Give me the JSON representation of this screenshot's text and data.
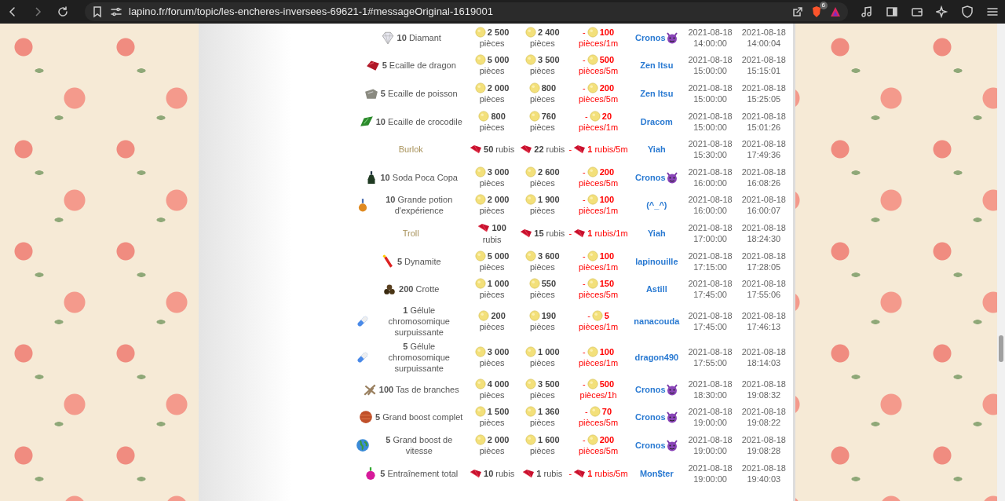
{
  "browser": {
    "url": "lapino.fr/forum/topic/les-encheres-inversees-69621-1#messageOriginal-1619001",
    "shield_count": "6"
  },
  "auctions": [
    {
      "item": {
        "kind": "diamond",
        "qty": "10",
        "name": "Diamant"
      },
      "kind": "coin",
      "start": {
        "value": "2 500",
        "unit": "pièces"
      },
      "final": {
        "value": "2 400",
        "unit": "pièces"
      },
      "step": {
        "sign": "-",
        "value": "100",
        "unit": "pièces/1m"
      },
      "winner": {
        "name": "Cronos",
        "devil": true
      },
      "opened": "2021-08-18 14:00:00",
      "closed": "2021-08-18 14:00:04"
    },
    {
      "item": {
        "kind": "scale-red",
        "qty": "5",
        "name": "Ecaille de dragon"
      },
      "kind": "coin",
      "start": {
        "value": "5 000",
        "unit": "pièces"
      },
      "final": {
        "value": "3 500",
        "unit": "pièces"
      },
      "step": {
        "sign": "-",
        "value": "500",
        "unit": "pièces/5m"
      },
      "winner": {
        "name": "Zen Itsu",
        "devil": false
      },
      "opened": "2021-08-18 15:00:00",
      "closed": "2021-08-18 15:15:01"
    },
    {
      "item": {
        "kind": "scale-grey",
        "qty": "5",
        "name": "Ecaille de poisson"
      },
      "kind": "coin",
      "start": {
        "value": "2 000",
        "unit": "pièces"
      },
      "final": {
        "value": "800",
        "unit": "pièces"
      },
      "step": {
        "sign": "-",
        "value": "200",
        "unit": "pièces/5m"
      },
      "winner": {
        "name": "Zen Itsu",
        "devil": false
      },
      "opened": "2021-08-18 15:00:00",
      "closed": "2021-08-18 15:25:05"
    },
    {
      "item": {
        "kind": "scale-green",
        "qty": "10",
        "name": "Ecaille de crocodile"
      },
      "kind": "coin",
      "start": {
        "value": "800",
        "unit": "pièces"
      },
      "final": {
        "value": "760",
        "unit": "pièces"
      },
      "step": {
        "sign": "-",
        "value": "20",
        "unit": "pièces/1m"
      },
      "winner": {
        "name": "Dracom",
        "devil": false
      },
      "opened": "2021-08-18 15:00:00",
      "closed": "2021-08-18 15:01:26"
    },
    {
      "item": {
        "kind": "creature",
        "name": "Burlok"
      },
      "kind": "ruby",
      "start": {
        "value": "50",
        "unit": "rubis"
      },
      "final": {
        "value": "22",
        "unit": "rubis"
      },
      "step": {
        "sign": "-",
        "value": "1",
        "unit": "rubis/5m"
      },
      "winner": {
        "name": "Yiah",
        "devil": false
      },
      "opened": "2021-08-18 15:30:00",
      "closed": "2021-08-18 17:49:36"
    },
    {
      "item": {
        "kind": "bottle",
        "qty": "10",
        "name": "Soda Poca Copa"
      },
      "kind": "coin",
      "start": {
        "value": "3 000",
        "unit": "pièces"
      },
      "final": {
        "value": "2 600",
        "unit": "pièces"
      },
      "step": {
        "sign": "-",
        "value": "200",
        "unit": "pièces/5m"
      },
      "winner": {
        "name": "Cronos",
        "devil": true
      },
      "opened": "2021-08-18 16:00:00",
      "closed": "2021-08-18 16:08:26"
    },
    {
      "item": {
        "kind": "potion",
        "qty": "10",
        "name": "Grande potion d'expérience"
      },
      "kind": "coin",
      "start": {
        "value": "2 000",
        "unit": "pièces"
      },
      "final": {
        "value": "1 900",
        "unit": "pièces"
      },
      "step": {
        "sign": "-",
        "value": "100",
        "unit": "pièces/1m"
      },
      "winner": {
        "name": "(^_^)",
        "devil": false
      },
      "opened": "2021-08-18 16:00:00",
      "closed": "2021-08-18 16:00:07"
    },
    {
      "item": {
        "kind": "creature",
        "name": "Troll"
      },
      "kind": "ruby",
      "start": {
        "value": "100",
        "unit": "rubis"
      },
      "final": {
        "value": "15",
        "unit": "rubis"
      },
      "step": {
        "sign": "-",
        "value": "1",
        "unit": "rubis/1m"
      },
      "winner": {
        "name": "Yiah",
        "devil": false
      },
      "opened": "2021-08-18 17:00:00",
      "closed": "2021-08-18 18:24:30"
    },
    {
      "item": {
        "kind": "dynamite",
        "qty": "5",
        "name": "Dynamite"
      },
      "kind": "coin",
      "start": {
        "value": "5 000",
        "unit": "pièces"
      },
      "final": {
        "value": "3 600",
        "unit": "pièces"
      },
      "step": {
        "sign": "-",
        "value": "100",
        "unit": "pièces/1m"
      },
      "winner": {
        "name": "lapinouille",
        "devil": false
      },
      "opened": "2021-08-18 17:15:00",
      "closed": "2021-08-18 17:28:05"
    },
    {
      "item": {
        "kind": "dung",
        "qty": "200",
        "name": "Crotte"
      },
      "kind": "coin",
      "start": {
        "value": "1 000",
        "unit": "pièces"
      },
      "final": {
        "value": "550",
        "unit": "pièces"
      },
      "step": {
        "sign": "-",
        "value": "150",
        "unit": "pièces/5m"
      },
      "winner": {
        "name": "Astill",
        "devil": false
      },
      "opened": "2021-08-18 17:45:00",
      "closed": "2021-08-18 17:55:06"
    },
    {
      "item": {
        "kind": "capsule",
        "qty": "1",
        "name": "Gélule chromosomique surpuissante"
      },
      "kind": "coin",
      "start": {
        "value": "200",
        "unit": "pièces"
      },
      "final": {
        "value": "190",
        "unit": "pièces"
      },
      "step": {
        "sign": "-",
        "value": "5",
        "unit": "pièces/1m"
      },
      "winner": {
        "name": "nanacouda",
        "devil": false
      },
      "opened": "2021-08-18 17:45:00",
      "closed": "2021-08-18 17:46:13"
    },
    {
      "item": {
        "kind": "capsule",
        "qty": "5",
        "name": "Gélule chromosomique surpuissante"
      },
      "kind": "coin",
      "start": {
        "value": "3 000",
        "unit": "pièces"
      },
      "final": {
        "value": "1 000",
        "unit": "pièces"
      },
      "step": {
        "sign": "-",
        "value": "100",
        "unit": "pièces/1m"
      },
      "winner": {
        "name": "dragon490",
        "devil": false
      },
      "opened": "2021-08-18 17:55:00",
      "closed": "2021-08-18 18:14:03"
    },
    {
      "item": {
        "kind": "branches",
        "qty": "100",
        "name": "Tas de branches"
      },
      "kind": "coin",
      "start": {
        "value": "4 000",
        "unit": "pièces"
      },
      "final": {
        "value": "3 500",
        "unit": "pièces"
      },
      "step": {
        "sign": "-",
        "value": "500",
        "unit": "pièces/1h"
      },
      "winner": {
        "name": "Cronos",
        "devil": true
      },
      "opened": "2021-08-18 18:30:00",
      "closed": "2021-08-18 19:08:32"
    },
    {
      "item": {
        "kind": "planet",
        "qty": "5",
        "name": "Grand boost complet"
      },
      "kind": "coin",
      "start": {
        "value": "1 500",
        "unit": "pièces"
      },
      "final": {
        "value": "1 360",
        "unit": "pièces"
      },
      "step": {
        "sign": "-",
        "value": "70",
        "unit": "pièces/5m"
      },
      "winner": {
        "name": "Cronos",
        "devil": true
      },
      "opened": "2021-08-18 19:00:00",
      "closed": "2021-08-18 19:08:22"
    },
    {
      "item": {
        "kind": "globe",
        "qty": "5",
        "name": "Grand boost de vitesse"
      },
      "kind": "coin",
      "start": {
        "value": "2 000",
        "unit": "pièces"
      },
      "final": {
        "value": "1 600",
        "unit": "pièces"
      },
      "step": {
        "sign": "-",
        "value": "200",
        "unit": "pièces/5m"
      },
      "winner": {
        "name": "Cronos",
        "devil": true
      },
      "opened": "2021-08-18 19:00:00",
      "closed": "2021-08-18 19:08:28"
    },
    {
      "item": {
        "kind": "flask",
        "qty": "5",
        "name": "Entraînement total"
      },
      "kind": "ruby",
      "start": {
        "value": "10",
        "unit": "rubis"
      },
      "final": {
        "value": "1",
        "unit": "rubis"
      },
      "step": {
        "sign": "-",
        "value": "1",
        "unit": "rubis/5m"
      },
      "winner": {
        "name": "Mon$ter",
        "devil": false
      },
      "opened": "2021-08-18 19:00:00",
      "closed": "2021-08-18 19:40:03"
    }
  ]
}
